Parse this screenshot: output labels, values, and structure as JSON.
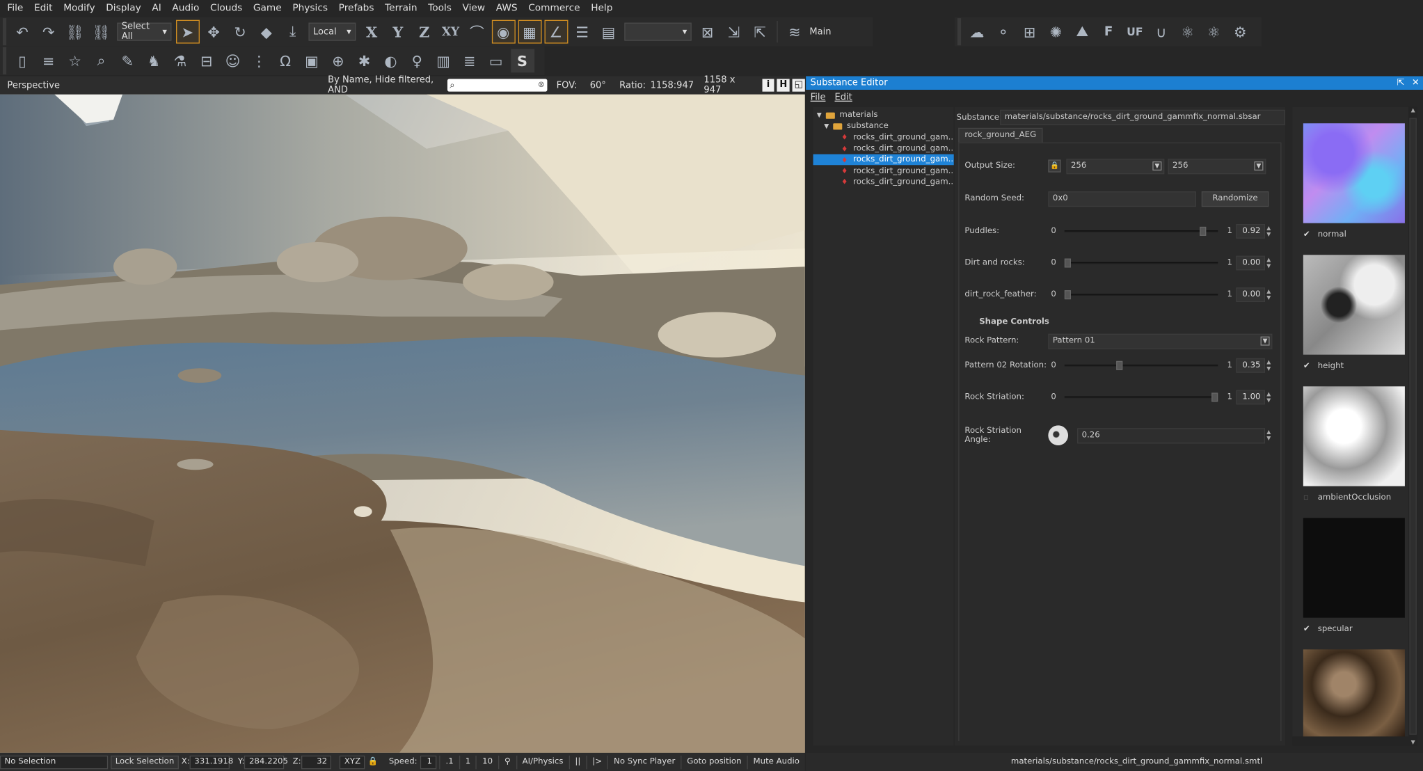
{
  "menu": [
    "File",
    "Edit",
    "Modify",
    "Display",
    "AI",
    "Audio",
    "Clouds",
    "Game",
    "Physics",
    "Prefabs",
    "Terrain",
    "Tools",
    "View",
    "AWS",
    "Commerce",
    "Help"
  ],
  "toolbar": {
    "select_all_label": "Select All",
    "coord_system": "Local",
    "axis_x": "X",
    "axis_y": "Y",
    "axis_z": "Z",
    "axis_xy": "XY",
    "layer_label": "Main",
    "icon_f": "F",
    "icon_uf": "UF"
  },
  "viewport": {
    "title": "Perspective",
    "filter_label": "By Name, Hide filtered, AND",
    "search_placeholder": "",
    "fov_label": "FOV:",
    "fov_value": "60°",
    "ratio_label": "Ratio:",
    "ratio_value": "1158:947",
    "size_value": "1158 x 947",
    "btn_i": "i",
    "btn_h": "H"
  },
  "substance_editor": {
    "title": "Substance Editor",
    "menu_file": "File",
    "menu_edit": "Edit",
    "tree": {
      "root": "materials",
      "folder": "substance",
      "items": [
        "rocks_dirt_ground_gam...",
        "rocks_dirt_ground_gam...",
        "rocks_dirt_ground_gam...",
        "rocks_dirt_ground_gam...",
        "rocks_dirt_ground_gam..."
      ],
      "selected_index": 2
    },
    "substance_label": "Substance:",
    "substance_path": "materials/substance/rocks_dirt_ground_gammfix_normal.sbsar",
    "tab": "rock_ground_AEG",
    "output_size_label": "Output Size:",
    "output_w": "256",
    "output_h": "256",
    "random_seed_label": "Random Seed:",
    "random_seed_value": "0x0",
    "randomize_label": "Randomize",
    "sliders": [
      {
        "label": "Puddles:",
        "min": "0",
        "max": "1",
        "value": "0.92",
        "level": 0.92
      },
      {
        "label": "Dirt and rocks:",
        "min": "0",
        "max": "1",
        "value": "0.00",
        "level": 0.0
      },
      {
        "label": "dirt_rock_feather:",
        "min": "0",
        "max": "1",
        "value": "0.00",
        "level": 0.0
      }
    ],
    "shape_controls_label": "Shape Controls",
    "rock_pattern_label": "Rock Pattern:",
    "rock_pattern_value": "Pattern 01",
    "shape_sliders": [
      {
        "label": "Pattern 02 Rotation:",
        "min": "0",
        "max": "1",
        "value": "0.35",
        "level": 0.35
      },
      {
        "label": "Rock Striation:",
        "min": "0",
        "max": "1",
        "value": "1.00",
        "level": 1.0
      }
    ],
    "striation_angle_label": "Rock Striation Angle:",
    "striation_angle_value": "0.26",
    "maps": [
      {
        "label": "normal",
        "checked": true
      },
      {
        "label": "height",
        "checked": true
      },
      {
        "label": "ambientOcclusion",
        "checked": false
      },
      {
        "label": "specular",
        "checked": true
      },
      {
        "label": "",
        "checked": false
      }
    ],
    "footer_path": "materials/substance/rocks_dirt_ground_gammfix_normal.smtl"
  },
  "statusbar": {
    "selection": "No Selection",
    "lock_selection": "Lock Selection",
    "x_label": "X:",
    "x_value": "331.1918",
    "y_label": "Y:",
    "y_value": "284.2205",
    "z_label": "Z:",
    "z_value": "32",
    "xyz_label": "XYZ",
    "speed_label": "Speed:",
    "speed_value": "1",
    "speed_opts": [
      ".1",
      "1",
      "10"
    ],
    "ai_physics": "AI/Physics",
    "no_sync": "No Sync Player",
    "goto": "Goto position",
    "mute": "Mute Audio"
  }
}
